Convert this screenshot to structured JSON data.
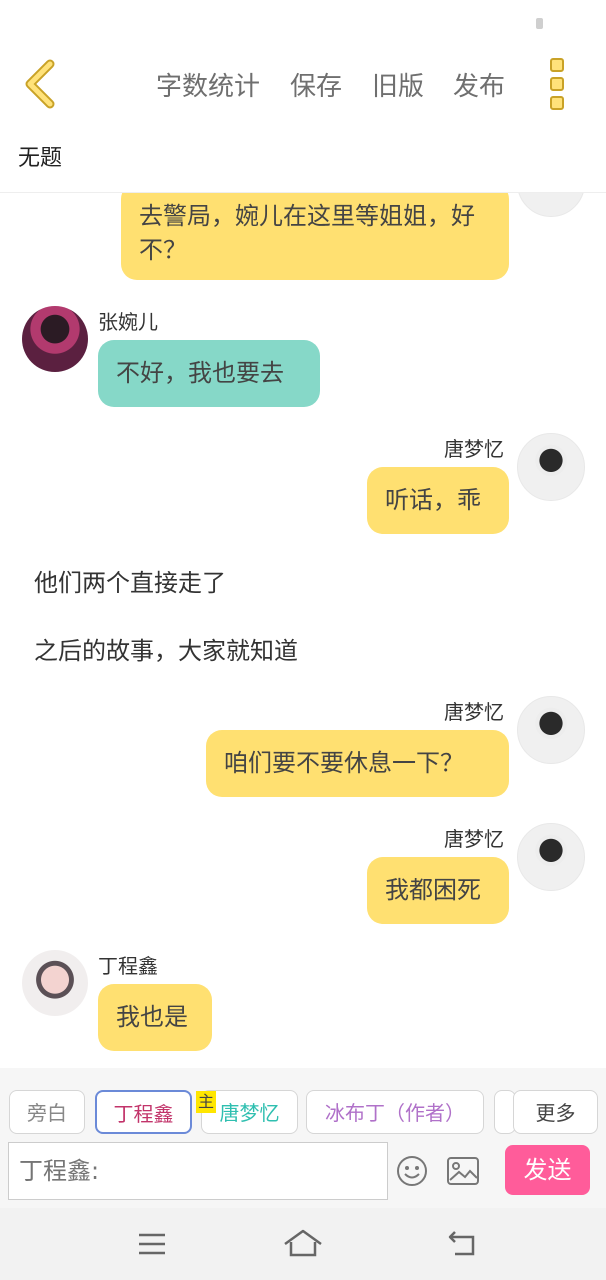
{
  "header": {
    "actions": [
      "字数统计",
      "保存",
      "旧版",
      "发布"
    ],
    "doc_title": "无题"
  },
  "messages": [
    {
      "type": "right",
      "speaker": "",
      "text": "去警局，婉儿在这里等姐姐，好不？"
    },
    {
      "type": "left",
      "speaker": "张婉儿",
      "text": "不好，我也要去"
    },
    {
      "type": "right",
      "speaker": "唐梦忆",
      "text": "听话，乖"
    },
    {
      "type": "narration",
      "text": "他们两个直接走了"
    },
    {
      "type": "narration",
      "text": "之后的故事，大家就知道"
    },
    {
      "type": "right",
      "speaker": "唐梦忆",
      "text": "咱们要不要休息一下？"
    },
    {
      "type": "right",
      "speaker": "唐梦忆",
      "text": "我都困死"
    },
    {
      "type": "left",
      "speaker": "丁程鑫",
      "text": "我也是"
    }
  ],
  "roles": {
    "chips": [
      {
        "label": "旁白",
        "color": "#888888"
      },
      {
        "label": "丁程鑫",
        "color": "#c2336a"
      },
      {
        "label": "唐梦忆",
        "color": "#2fbfb0"
      },
      {
        "label": "冰布丁（作者）",
        "color": "#b071c9"
      },
      {
        "label": "更多",
        "color": "#444444"
      }
    ],
    "main_tag": "主"
  },
  "composer": {
    "placeholder": "丁程鑫:",
    "send_label": "发送"
  },
  "colors": {
    "bubble_yellow": "#ffe071",
    "bubble_teal": "#86d8c8",
    "send_button": "#ff5c9a",
    "accent_icon": "#c9a227"
  },
  "icons": [
    "back-chevron-icon",
    "more-vertical-icon",
    "emoji-icon",
    "image-icon",
    "menu-icon",
    "home-icon",
    "return-icon"
  ]
}
